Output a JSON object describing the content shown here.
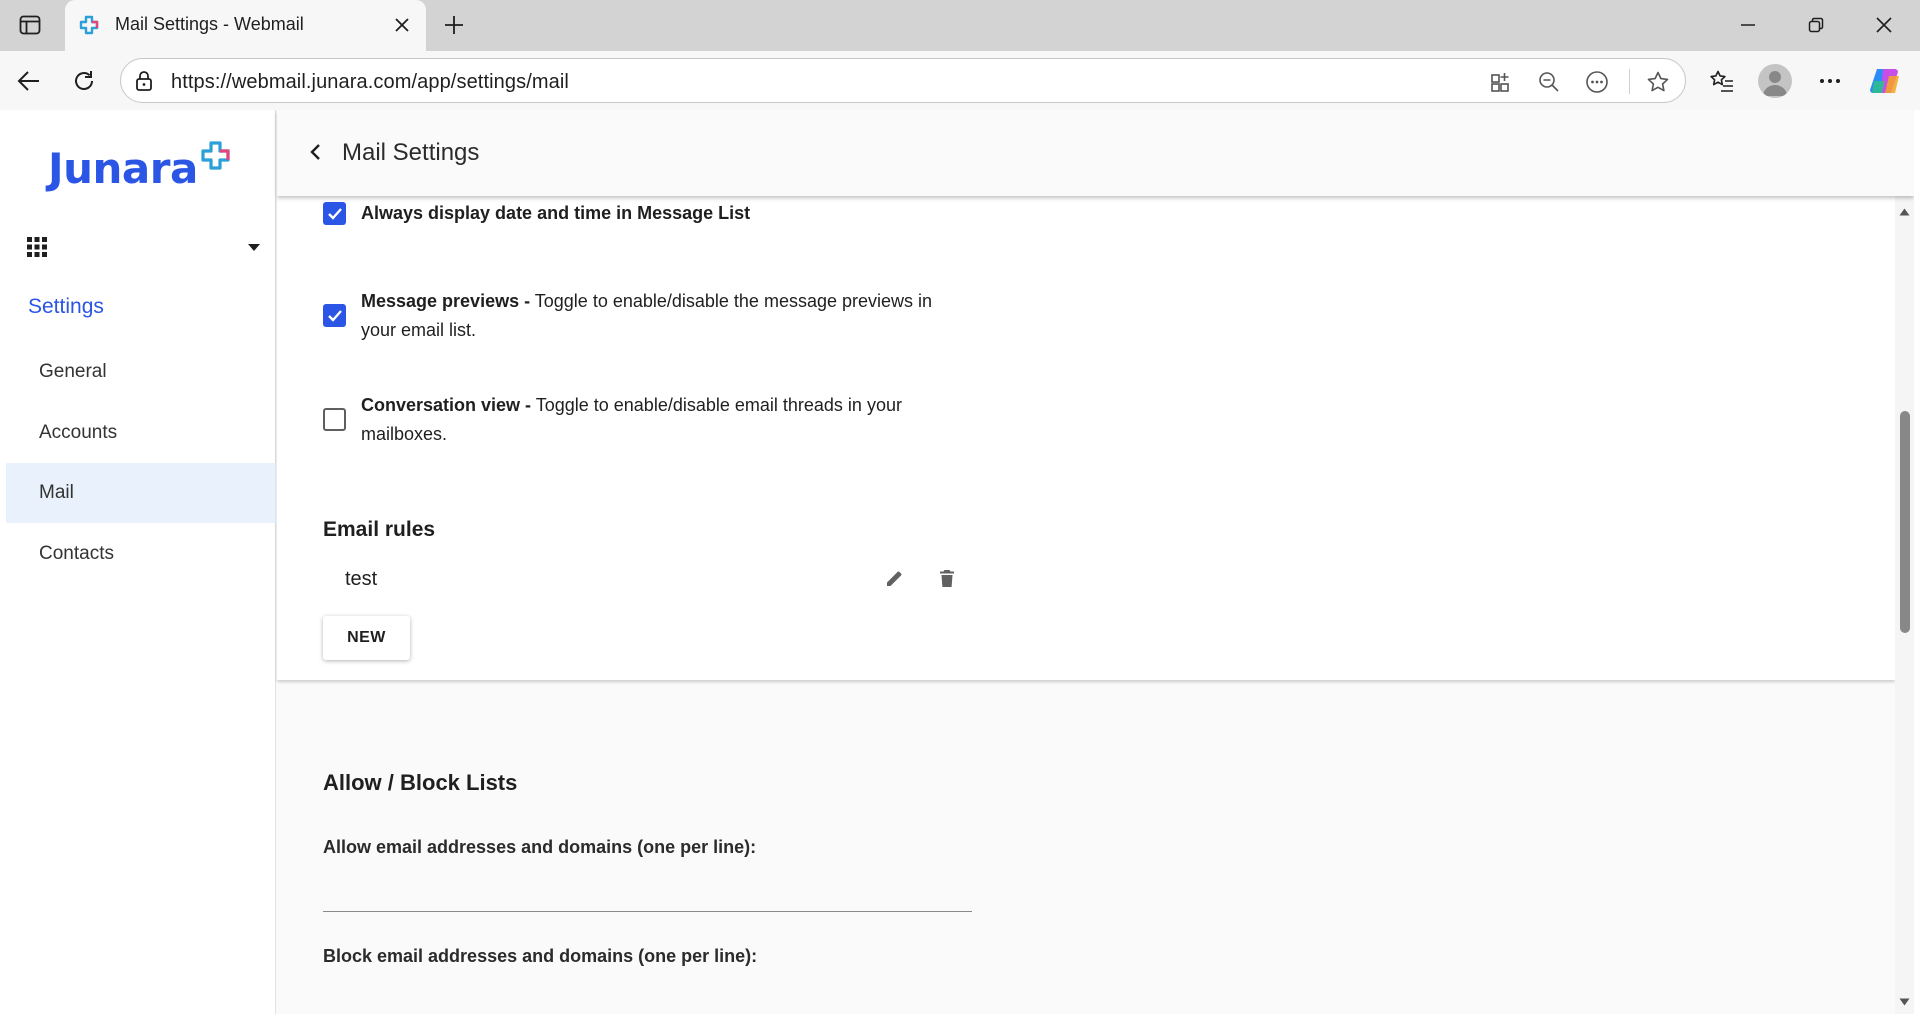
{
  "browser": {
    "tab_title": "Mail Settings - Webmail",
    "url": "https://webmail.junara.com/app/settings/mail"
  },
  "sidebar": {
    "logo_text": "Junara",
    "heading": "Settings",
    "items": [
      {
        "label": "General",
        "active": false
      },
      {
        "label": "Accounts",
        "active": false
      },
      {
        "label": "Mail",
        "active": true
      },
      {
        "label": "Contacts",
        "active": false
      }
    ]
  },
  "header": {
    "title": "Mail Settings"
  },
  "mail_options": [
    {
      "bold": "Always display date and time in Message List",
      "text": "",
      "checked": true
    },
    {
      "bold": "Message previews -",
      "text": " Toggle to enable/disable the message previews in your email list.",
      "checked": true
    },
    {
      "bold": "Conversation view -",
      "text": " Toggle to enable/disable email threads in your mailboxes.",
      "checked": false
    }
  ],
  "email_rules": {
    "title": "Email rules",
    "rules": [
      {
        "name": "test"
      }
    ],
    "new_label": "NEW"
  },
  "allow_block": {
    "title": "Allow / Block Lists",
    "allow_label": "Allow email addresses and domains (one per line):",
    "allow_value": "",
    "block_label": "Block email addresses and domains (one per line):",
    "block_value": ""
  },
  "colors": {
    "accent": "#2a55e5",
    "active_nav_bg": "#e8f1fc"
  }
}
